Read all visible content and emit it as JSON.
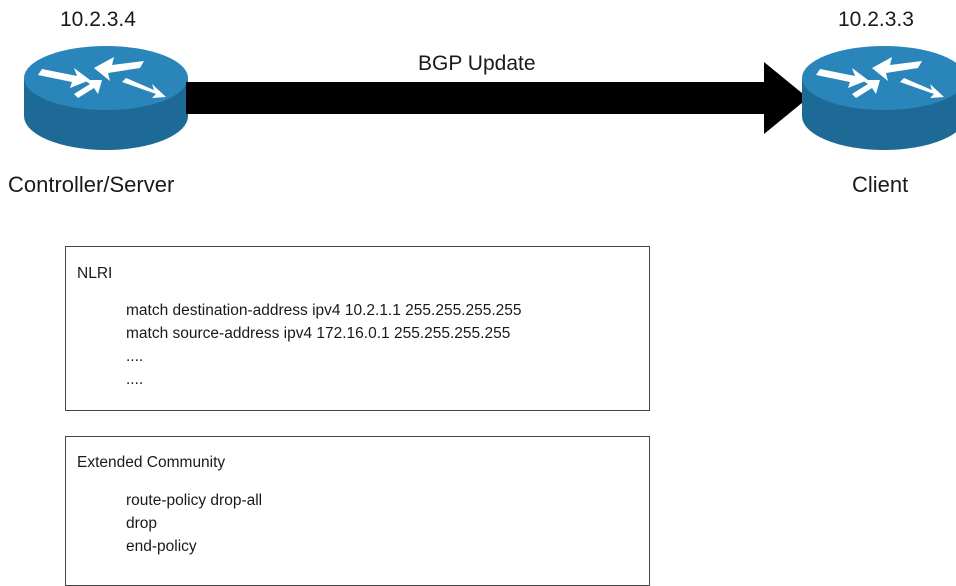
{
  "left_node": {
    "ip": "10.2.3.4",
    "label": "Controller/Server",
    "icon": "router-icon"
  },
  "right_node": {
    "ip": "10.2.3.3",
    "label": "Client",
    "icon": "router-icon"
  },
  "arrow": {
    "label": "BGP Update",
    "color": "#000000"
  },
  "nlri_box": {
    "title": "NLRI",
    "lines": [
      "match destination-address ipv4 10.2.1.1 255.255.255.255",
      "match source-address ipv4 172.16.0.1 255.255.255.255",
      "....",
      "...."
    ]
  },
  "community_box": {
    "title": "Extended Community",
    "lines": [
      "route-policy drop-all",
      "drop",
      "end-policy"
    ]
  },
  "colors": {
    "router_body": "#1d6a96",
    "router_top": "#2a86ba",
    "arrow_glyph": "#ffffff"
  }
}
